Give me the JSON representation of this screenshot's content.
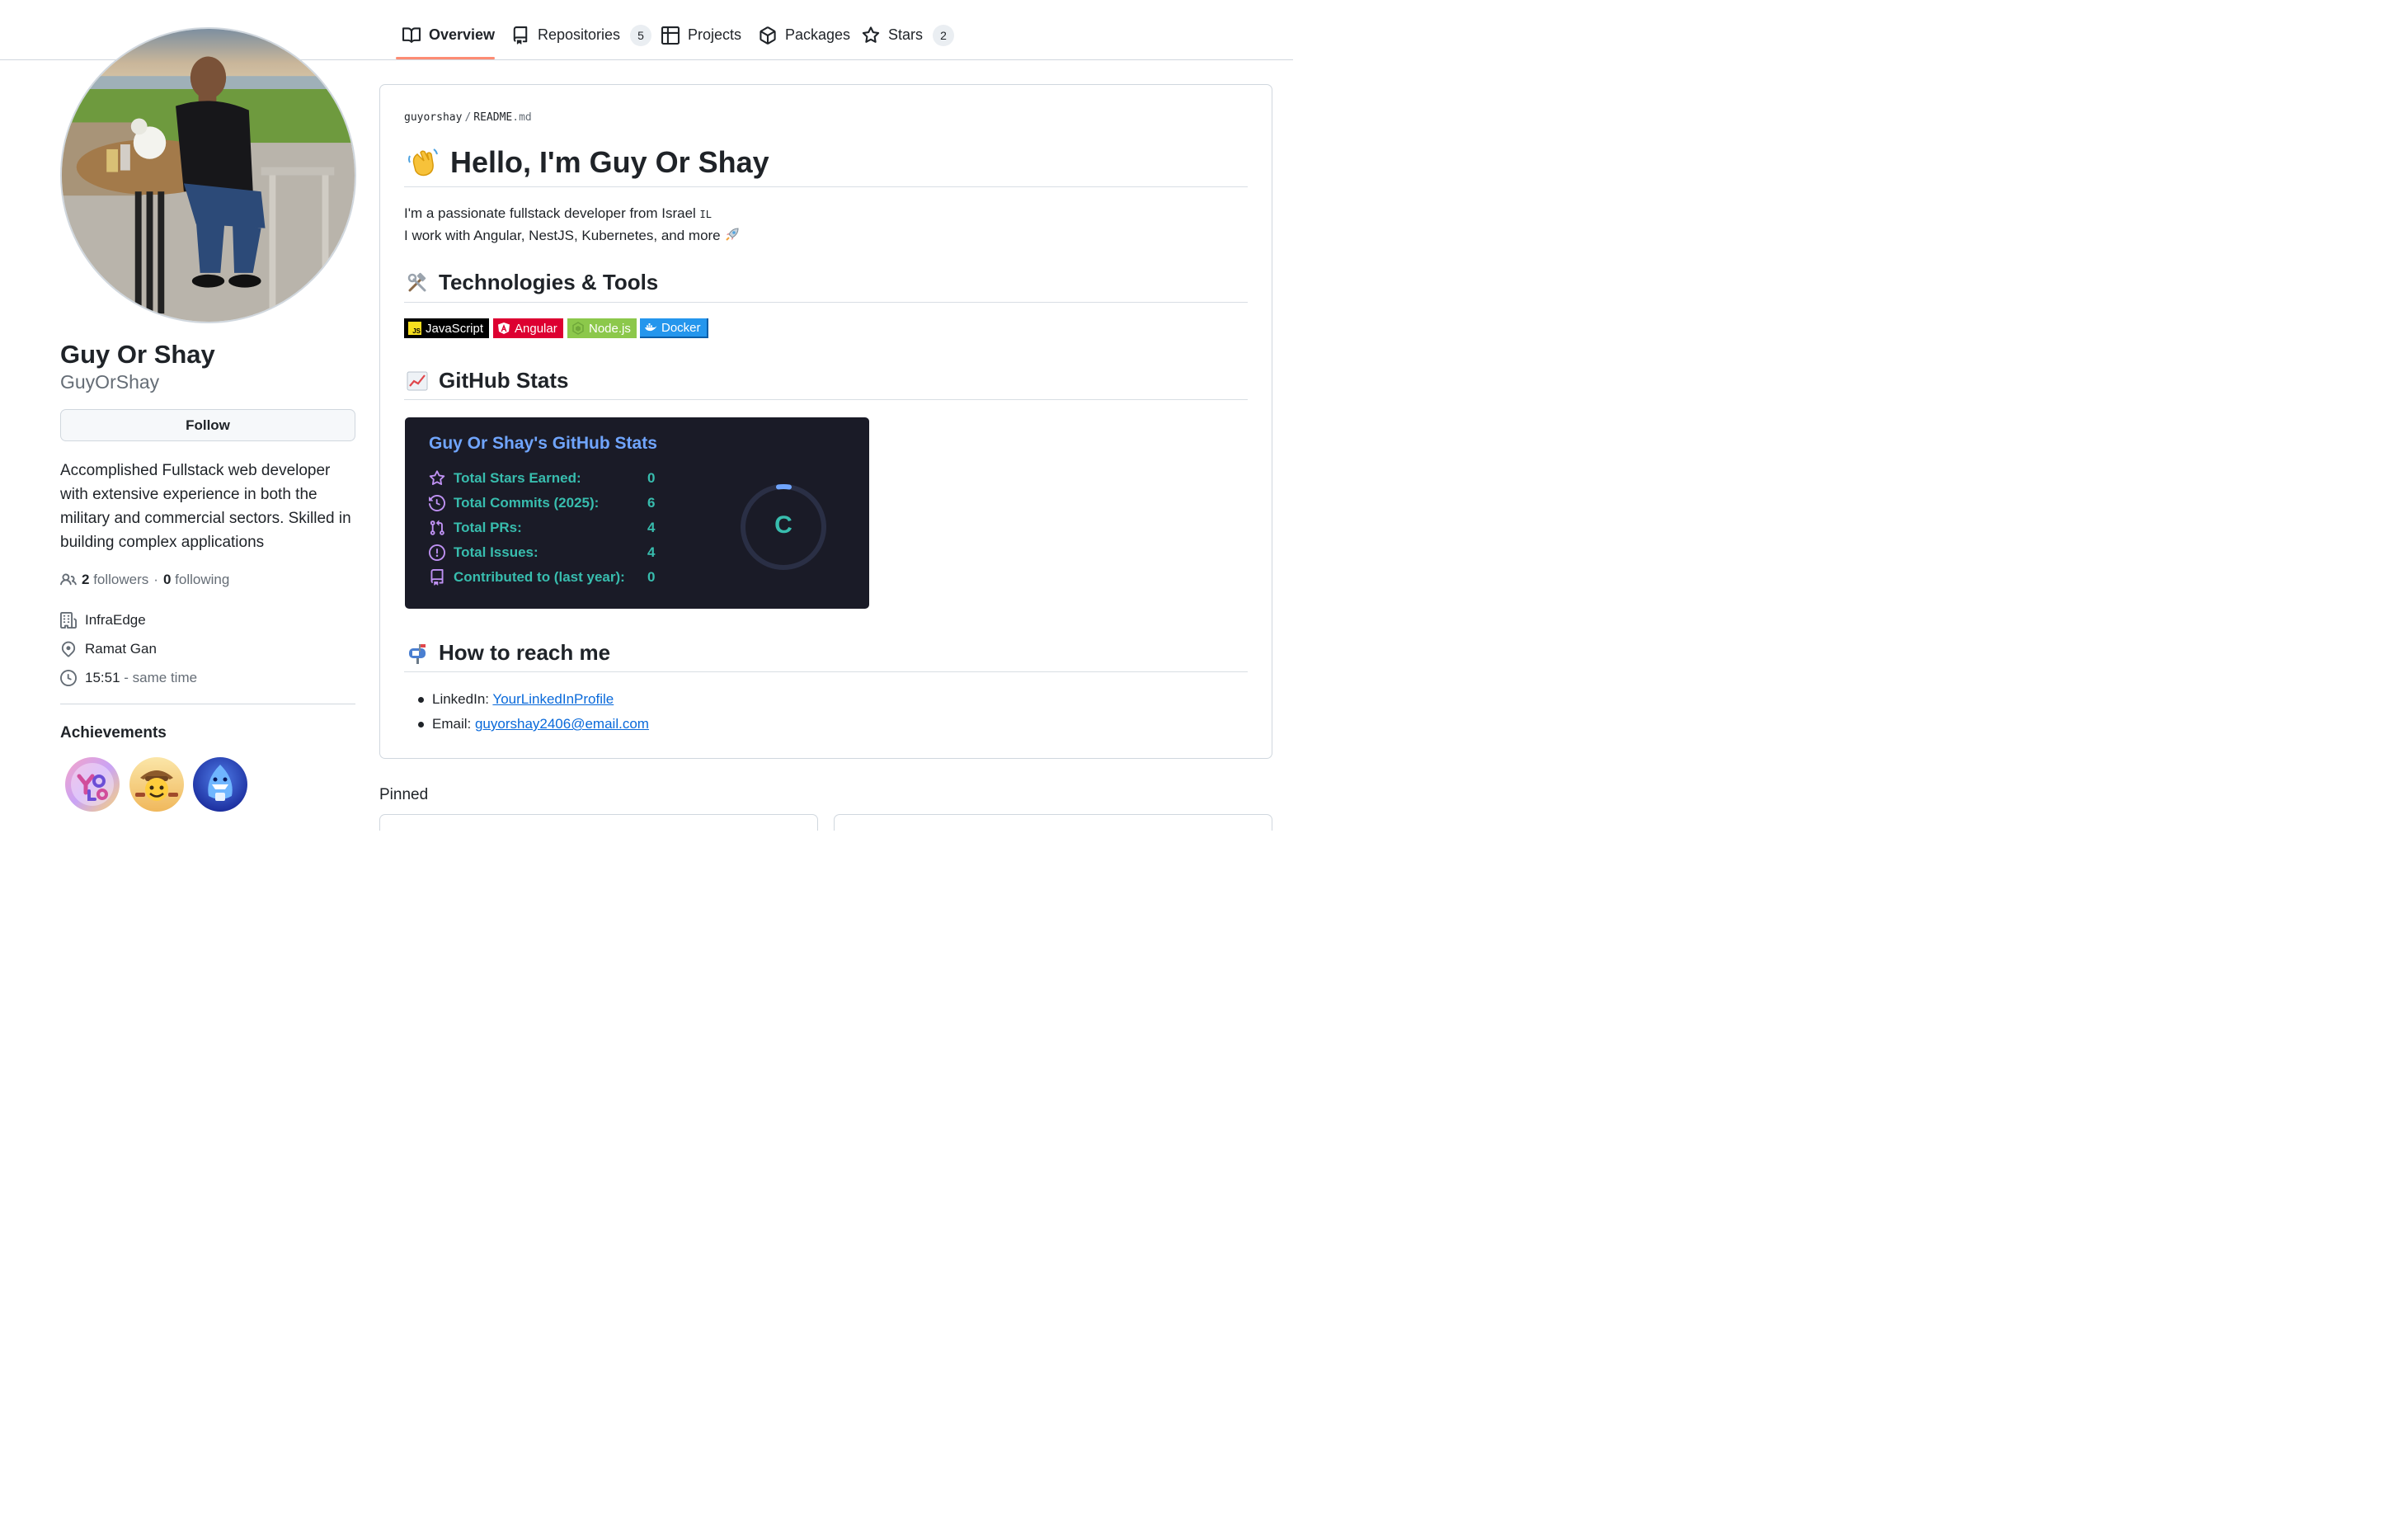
{
  "nav": {
    "tabs": [
      {
        "label": "Overview",
        "icon": "book-icon"
      },
      {
        "label": "Repositories",
        "count": "5",
        "icon": "repo-icon"
      },
      {
        "label": "Projects",
        "icon": "table-icon"
      },
      {
        "label": "Packages",
        "icon": "package-icon"
      },
      {
        "label": "Stars",
        "count": "2",
        "icon": "star-icon"
      }
    ],
    "accent": "#fd8c73"
  },
  "profile": {
    "name": "Guy Or Shay",
    "username": "GuyOrShay",
    "follow_label": "Follow",
    "bio": "Accomplished Fullstack web developer with extensive experience in both the military and commercial sectors. Skilled in building complex applications",
    "followers_count": "2",
    "followers_label": "followers",
    "separator": "·",
    "following_count": "0",
    "following_label": "following",
    "company": "InfraEdge",
    "location": "Ramat Gan",
    "time": "15:51",
    "time_note": "- same time",
    "achievements_title": "Achievements"
  },
  "readme": {
    "owner": "guyorshay",
    "sep": "/",
    "file": "README",
    "ext": ".md",
    "h1": "Hello, I'm Guy Or Shay",
    "intro_line1": "I'm a passionate fullstack developer from Israel",
    "flag_text": "IL",
    "intro_line2": "I work with Angular, NestJS, Kubernetes, and more",
    "h2_tech": "Technologies & Tools",
    "badges": [
      {
        "label": "JavaScript",
        "color": "#000000",
        "logo": "JS"
      },
      {
        "label": "Angular",
        "color": "#dd0031"
      },
      {
        "label": "Node.js",
        "color": "#8cc84b"
      },
      {
        "label": "Docker",
        "color": "#2496ed"
      }
    ],
    "h2_stats": "GitHub Stats",
    "h2_reach": "How to reach me",
    "contacts": [
      {
        "label": "LinkedIn:",
        "link": "YourLinkedInProfile"
      },
      {
        "label": "Email:",
        "link": "guyorshay2406@email.com"
      }
    ]
  },
  "stats_card": {
    "title": "Guy Or Shay's GitHub Stats",
    "rows": [
      {
        "label": "Total Stars Earned:",
        "value": "0",
        "icon": "star-icon"
      },
      {
        "label": "Total Commits (2025):",
        "value": "6",
        "icon": "history-icon"
      },
      {
        "label": "Total PRs:",
        "value": "4",
        "icon": "pull-request-icon"
      },
      {
        "label": "Total Issues:",
        "value": "4",
        "icon": "issue-icon"
      },
      {
        "label": "Contributed to (last year):",
        "value": "0",
        "icon": "repo-icon"
      }
    ],
    "rank": "C",
    "title_color": "#70a5fd",
    "text_color": "#38bdae",
    "icon_color": "#bf91f3",
    "bg_color": "#1a1b27"
  },
  "pinned_title": "Pinned"
}
